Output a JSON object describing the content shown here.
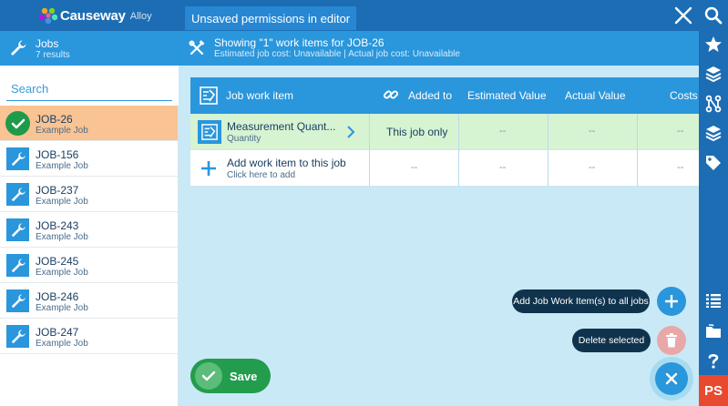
{
  "app": {
    "brand_name": "Causeway",
    "brand_sub": "Alloy",
    "tab_label": "Unsaved permissions in editor"
  },
  "left_panel": {
    "title": "Jobs",
    "subtitle": "7 results",
    "search_placeholder": "Search",
    "jobs": [
      {
        "name": "JOB-26",
        "sub": "Example Job",
        "selected": true
      },
      {
        "name": "JOB-156",
        "sub": "Example Job"
      },
      {
        "name": "JOB-237",
        "sub": "Example Job"
      },
      {
        "name": "JOB-243",
        "sub": "Example Job"
      },
      {
        "name": "JOB-245",
        "sub": "Example Job"
      },
      {
        "name": "JOB-246",
        "sub": "Example Job"
      },
      {
        "name": "JOB-247",
        "sub": "Example Job"
      }
    ]
  },
  "main": {
    "title": "Showing \"1\" work items for JOB-26",
    "subtitle": "Estimated job cost: Unavailable | Actual job cost: Unavailable",
    "columns": {
      "item": "Job work item",
      "added_to": "Added to",
      "estimated": "Estimated Value",
      "actual": "Actual Value",
      "costs": "Costs"
    },
    "rows": [
      {
        "name": "Measurement Quant...",
        "sub": "Quantity",
        "added_to": "This job only",
        "estimated": "--",
        "actual": "--",
        "costs": "--"
      }
    ],
    "add_row": {
      "name": "Add work item to this job",
      "sub": "Click here to add",
      "added_to": "--",
      "estimated": "--",
      "actual": "--",
      "costs": "--"
    }
  },
  "actions": {
    "add_all_label": "Add Job Work Item(s) to all jobs",
    "delete_label": "Delete selected",
    "save_label": "Save"
  },
  "rail": {
    "ps_label": "PS"
  },
  "colors": {
    "topbar": "#1c6db3",
    "header": "#2a96dc",
    "selected_job": "#f9c393",
    "selected_row": "#d6f3d2",
    "save": "#239c4e",
    "ps": "#e84a30"
  }
}
